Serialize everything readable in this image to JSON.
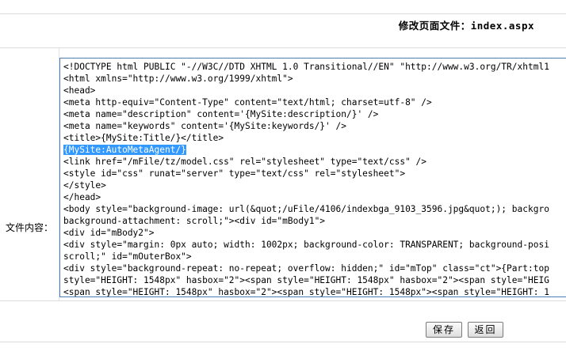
{
  "header": {
    "title_prefix": "修改页面文件：",
    "file_name": "index.aspx"
  },
  "form": {
    "content_label": "文件内容：",
    "code_lines": [
      "<!DOCTYPE html PUBLIC \"-//W3C//DTD XHTML 1.0 Transitional//EN\" \"http://www.w3.org/TR/xhtml1",
      "<html xmlns=\"http://www.w3.org/1999/xhtml\">",
      "<head>",
      "<meta http-equiv=\"Content-Type\" content=\"text/html; charset=utf-8\" />",
      "<meta name=\"description\" content='{MySite:description/}' />",
      "<meta name=\"keywords\" content='{MySite:keywords/}' />",
      "<title>{MySite:Title/}</title>",
      "{MySite:AutoMetaAgent/}",
      "<link href=\"/mFile/tz/model.css\" rel=\"stylesheet\" type=\"text/css\" />",
      "<style id=\"css\" runat=\"server\" type=\"text/css\" rel=\"stylesheet\">",
      "</style>",
      "</head>",
      "<body style=\"background-image: url(&quot;/uFile/4106/indexbga_9103_3596.jpg&quot;); backgro",
      "background-attachment: scroll;\"><div id=\"mBody1\">",
      "<div id=\"mBody2\">",
      "<div style=\"margin: 0px auto; width: 1002px; background-color: TRANSPARENT; background-posi",
      "scroll;\" id=\"mOuterBox\">",
      "<div style=\"background-repeat: no-repeat; overflow: hidden;\" id=\"mTop\" class=\"ct\">{Part:top",
      "style=\"HEIGHT: 1548px\" hasbox=\"2\"><span style=\"HEIGHT: 1548px\" hasbox=\"2\"><span style=\"HEIG",
      "<span style=\"HEIGHT: 1548px\" hasbox=\"2\"><span style=\"HEIGHT: 1548px\"><span style=\"HEIGHT: 1"
    ],
    "selected_line": 7
  },
  "buttons": {
    "save_label": "保存",
    "back_label": "返回"
  },
  "colors": {
    "selection": "#3399ff",
    "editor_border": "#4a7fb5"
  }
}
